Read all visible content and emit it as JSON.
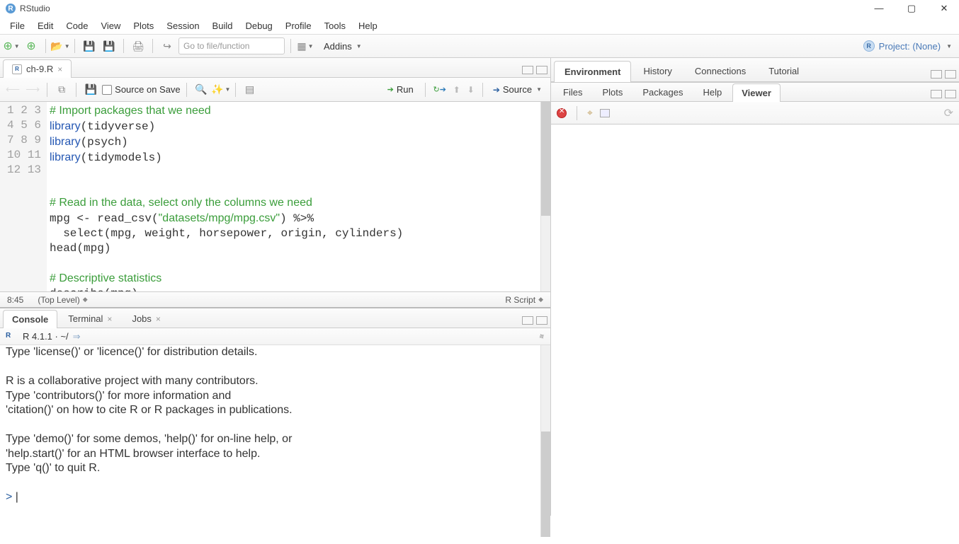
{
  "window": {
    "title": "RStudio",
    "min": "—",
    "max": "▢",
    "close": "✕"
  },
  "menu": [
    "File",
    "Edit",
    "Code",
    "View",
    "Plots",
    "Session",
    "Build",
    "Debug",
    "Profile",
    "Tools",
    "Help"
  ],
  "toolbar": {
    "goto_placeholder": "Go to file/function",
    "addins": "Addins",
    "project": "Project: (None)"
  },
  "source": {
    "tab": "ch-9.R",
    "source_on_save": "Source on Save",
    "run": "Run",
    "source_btn": "Source",
    "cursor": "8:45",
    "scope": "(Top Level)",
    "file_type": "R Script",
    "lines": [
      {
        "n": 1,
        "type": "comment",
        "text": "# Import packages that we need"
      },
      {
        "n": 2,
        "type": "lib",
        "fn": "library",
        "arg": "tidyverse"
      },
      {
        "n": 3,
        "type": "lib",
        "fn": "library",
        "arg": "psych"
      },
      {
        "n": 4,
        "type": "lib",
        "fn": "library",
        "arg": "tidymodels"
      },
      {
        "n": 5,
        "type": "blank"
      },
      {
        "n": 6,
        "type": "blank"
      },
      {
        "n": 7,
        "type": "comment",
        "text": "# Read in the data, select only the columns we need"
      },
      {
        "n": 8,
        "type": "raw",
        "html": "mpg &lt;- read_csv(<span class='str'>\"datasets/mpg/mpg.csv\"</span>) %&gt;% "
      },
      {
        "n": 9,
        "type": "plain",
        "text": "  select(mpg, weight, horsepower, origin, cylinders)"
      },
      {
        "n": 10,
        "type": "plain",
        "text": "head(mpg)"
      },
      {
        "n": 11,
        "type": "blank"
      },
      {
        "n": 12,
        "type": "comment",
        "text": "# Descriptive statistics"
      },
      {
        "n": 13,
        "type": "plain",
        "text": "describe(mpg)"
      }
    ]
  },
  "console": {
    "tabs": [
      "Console",
      "Terminal",
      "Jobs"
    ],
    "version": "R 4.1.1 · ~/",
    "arrow": "⇒",
    "text": "Type 'license()' or 'licence()' for distribution details.\n\nR is a collaborative project with many contributors.\nType 'contributors()' for more information and\n'citation()' on how to cite R or R packages in publications.\n\nType 'demo()' for some demos, 'help()' for on-line help, or\n'help.start()' for an HTML browser interface to help.\nType 'q()' to quit R.\n",
    "prompt": "> "
  },
  "right_top_tabs": [
    "Environment",
    "History",
    "Connections",
    "Tutorial"
  ],
  "right_bottom_tabs": [
    "Files",
    "Plots",
    "Packages",
    "Help",
    "Viewer"
  ]
}
